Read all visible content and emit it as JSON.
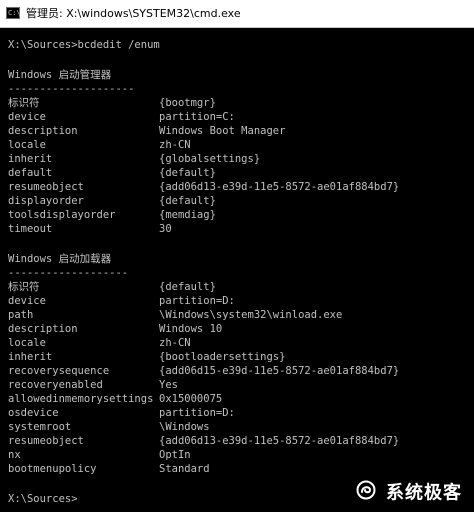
{
  "window": {
    "title": "管理员: X:\\windows\\SYSTEM32\\cmd.exe",
    "icon": "cmd-console-icon",
    "icon_text": "C:\\"
  },
  "console": {
    "command_line": "X:\\Sources>bcdedit /enum",
    "sections": [
      {
        "header": "Windows 启动管理器",
        "separator": "--------------------",
        "entries": [
          {
            "key": "标识符",
            "value": "{bootmgr}"
          },
          {
            "key": "device",
            "value": "partition=C:"
          },
          {
            "key": "description",
            "value": "Windows Boot Manager"
          },
          {
            "key": "locale",
            "value": "zh-CN"
          },
          {
            "key": "inherit",
            "value": "{globalsettings}"
          },
          {
            "key": "default",
            "value": "{default}"
          },
          {
            "key": "resumeobject",
            "value": "{add06d13-e39d-11e5-8572-ae01af884bd7}"
          },
          {
            "key": "displayorder",
            "value": "{default}"
          },
          {
            "key": "toolsdisplayorder",
            "value": "{memdiag}"
          },
          {
            "key": "timeout",
            "value": "30"
          }
        ]
      },
      {
        "header": "Windows 启动加载器",
        "separator": "-------------------",
        "entries": [
          {
            "key": "标识符",
            "value": "{default}"
          },
          {
            "key": "device",
            "value": "partition=D:"
          },
          {
            "key": "path",
            "value": "\\Windows\\system32\\winload.exe"
          },
          {
            "key": "description",
            "value": "Windows 10"
          },
          {
            "key": "locale",
            "value": "zh-CN"
          },
          {
            "key": "inherit",
            "value": "{bootloadersettings}"
          },
          {
            "key": "recoverysequence",
            "value": "{add06d15-e39d-11e5-8572-ae01af884bd7}"
          },
          {
            "key": "recoveryenabled",
            "value": "Yes"
          },
          {
            "key": "allowedinmemorysettings",
            "value": "0x15000075"
          },
          {
            "key": "osdevice",
            "value": "partition=D:"
          },
          {
            "key": "systemroot",
            "value": "\\Windows"
          },
          {
            "key": "resumeobject",
            "value": "{add06d13-e39d-11e5-8572-ae01af884bd7}"
          },
          {
            "key": "nx",
            "value": "OptIn"
          },
          {
            "key": "bootmenupolicy",
            "value": "Standard"
          }
        ]
      }
    ],
    "prompt": "X:\\Sources>"
  },
  "watermark": {
    "text": "系统极客",
    "icon": "swirl-logo-icon"
  },
  "colors": {
    "console_bg": "#000000",
    "console_text": "#c0c0c0",
    "titlebar_bg": "#ffffff"
  }
}
